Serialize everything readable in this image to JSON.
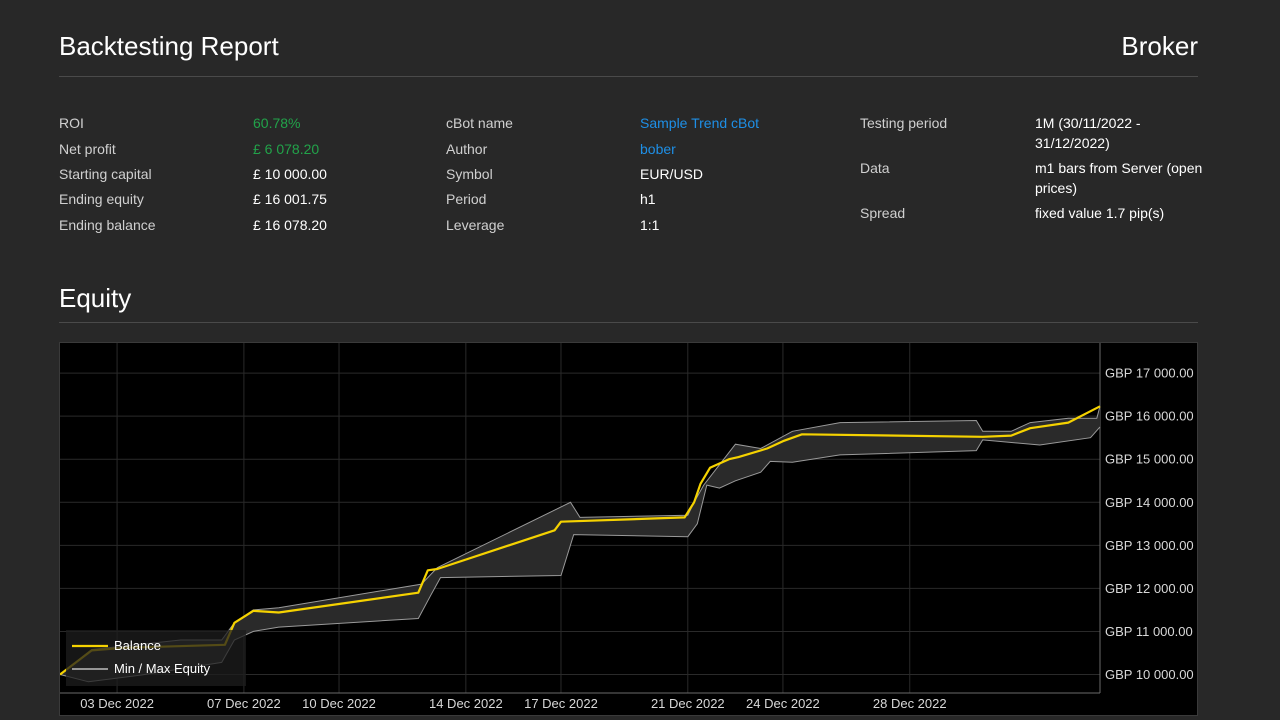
{
  "header": {
    "title": "Backtesting Report",
    "broker": "Broker"
  },
  "summary": {
    "col1": [
      {
        "label": "ROI",
        "value": "60.78%"
      },
      {
        "label": "Net profit",
        "value": "£ 6 078.20"
      },
      {
        "label": "Starting capital",
        "value": "£ 10 000.00"
      },
      {
        "label": "Ending equity",
        "value": "£ 16 001.75"
      },
      {
        "label": "Ending balance",
        "value": "£ 16 078.20"
      }
    ],
    "col2": [
      {
        "label": "cBot name",
        "value": "Sample Trend cBot"
      },
      {
        "label": "Author",
        "value": "bober"
      },
      {
        "label": "Symbol",
        "value": "EUR/USD"
      },
      {
        "label": "Period",
        "value": "h1"
      },
      {
        "label": "Leverage",
        "value": "1:1"
      }
    ],
    "col3": [
      {
        "label": "Testing period",
        "value": "1M (30/11/2022 - 31/12/2022)"
      },
      {
        "label": "Data",
        "value": "m1 bars from Server (open prices)"
      },
      {
        "label": "Spread",
        "value": "fixed value 1.7 pip(s)"
      }
    ]
  },
  "section": {
    "equity_title": "Equity"
  },
  "colors": {
    "balance": "#f5d200",
    "equity": "#9a9a9a",
    "positive": "#22a34a",
    "link": "#1e8fe6"
  },
  "chart_data": {
    "type": "line",
    "x_tick_labels": [
      "03 Dec 2022",
      "07 Dec 2022",
      "10 Dec 2022",
      "14 Dec 2022",
      "17 Dec 2022",
      "21 Dec 2022",
      "24 Dec 2022",
      "28 Dec 2022"
    ],
    "x_ticks": [
      2,
      6,
      9,
      13,
      16,
      20,
      23,
      27
    ],
    "xlim": [
      0.2,
      33.0
    ],
    "y_tick_labels": [
      "GBP 17 000.00",
      "GBP 16 000.00",
      "GBP 15 000.00",
      "GBP 14 000.00",
      "GBP 13 000.00",
      "GBP 12 000.00",
      "GBP 11 000.00",
      "GBP 10 000.00"
    ],
    "y_ticks": [
      17000,
      16000,
      15000,
      14000,
      13000,
      12000,
      11000,
      10000
    ],
    "ylim": [
      9570,
      17700
    ],
    "legend": {
      "position": "bottom-left",
      "items": [
        "Balance",
        "Min / Max Equity"
      ]
    },
    "series": [
      {
        "name": "Balance",
        "points": [
          [
            0.2,
            10000
          ],
          [
            1.2,
            10560
          ],
          [
            2.2,
            10620
          ],
          [
            5.4,
            10690
          ],
          [
            5.7,
            11200
          ],
          [
            6.3,
            11480
          ],
          [
            7.1,
            11440
          ],
          [
            11.5,
            11900
          ],
          [
            11.8,
            12420
          ],
          [
            12.1,
            12450
          ],
          [
            15.8,
            13350
          ],
          [
            16.0,
            13550
          ],
          [
            19.9,
            13650
          ],
          [
            20.2,
            14000
          ],
          [
            20.4,
            14430
          ],
          [
            20.7,
            14800
          ],
          [
            21.3,
            15000
          ],
          [
            21.6,
            15050
          ],
          [
            22.5,
            15250
          ],
          [
            23.0,
            15420
          ],
          [
            23.6,
            15580
          ],
          [
            29.3,
            15520
          ],
          [
            30.2,
            15550
          ],
          [
            30.8,
            15720
          ],
          [
            32.0,
            15850
          ],
          [
            33.0,
            16230
          ]
        ]
      },
      {
        "name": "Min / Max Equity",
        "max_points": [
          [
            0.2,
            10000
          ],
          [
            1.2,
            10580
          ],
          [
            4.0,
            10800
          ],
          [
            5.3,
            10800
          ],
          [
            5.7,
            11200
          ],
          [
            6.3,
            11500
          ],
          [
            7.1,
            11550
          ],
          [
            11.6,
            12100
          ],
          [
            12.1,
            12480
          ],
          [
            16.3,
            14000
          ],
          [
            16.6,
            13650
          ],
          [
            20.0,
            13700
          ],
          [
            20.2,
            14000
          ],
          [
            20.5,
            14400
          ],
          [
            21.5,
            15350
          ],
          [
            22.3,
            15250
          ],
          [
            23.3,
            15650
          ],
          [
            24.8,
            15850
          ],
          [
            29.1,
            15900
          ],
          [
            29.3,
            15650
          ],
          [
            30.2,
            15650
          ],
          [
            30.8,
            15850
          ],
          [
            32.0,
            15950
          ],
          [
            32.9,
            15950
          ],
          [
            33.0,
            16230
          ]
        ],
        "min_points": [
          [
            0.2,
            10000
          ],
          [
            1.1,
            9830
          ],
          [
            2.8,
            9990
          ],
          [
            5.3,
            10280
          ],
          [
            5.7,
            10800
          ],
          [
            6.3,
            11000
          ],
          [
            7.1,
            11100
          ],
          [
            11.5,
            11300
          ],
          [
            11.9,
            11850
          ],
          [
            12.2,
            12250
          ],
          [
            16.0,
            12300
          ],
          [
            16.4,
            13250
          ],
          [
            20.0,
            13200
          ],
          [
            20.3,
            13500
          ],
          [
            20.6,
            14400
          ],
          [
            21.0,
            14330
          ],
          [
            21.5,
            14500
          ],
          [
            22.3,
            14700
          ],
          [
            22.6,
            14950
          ],
          [
            23.3,
            14930
          ],
          [
            24.8,
            15100
          ],
          [
            29.1,
            15200
          ],
          [
            29.3,
            15450
          ],
          [
            31.1,
            15330
          ],
          [
            32.7,
            15500
          ],
          [
            33.0,
            15750
          ]
        ]
      }
    ],
    "grid": true
  }
}
